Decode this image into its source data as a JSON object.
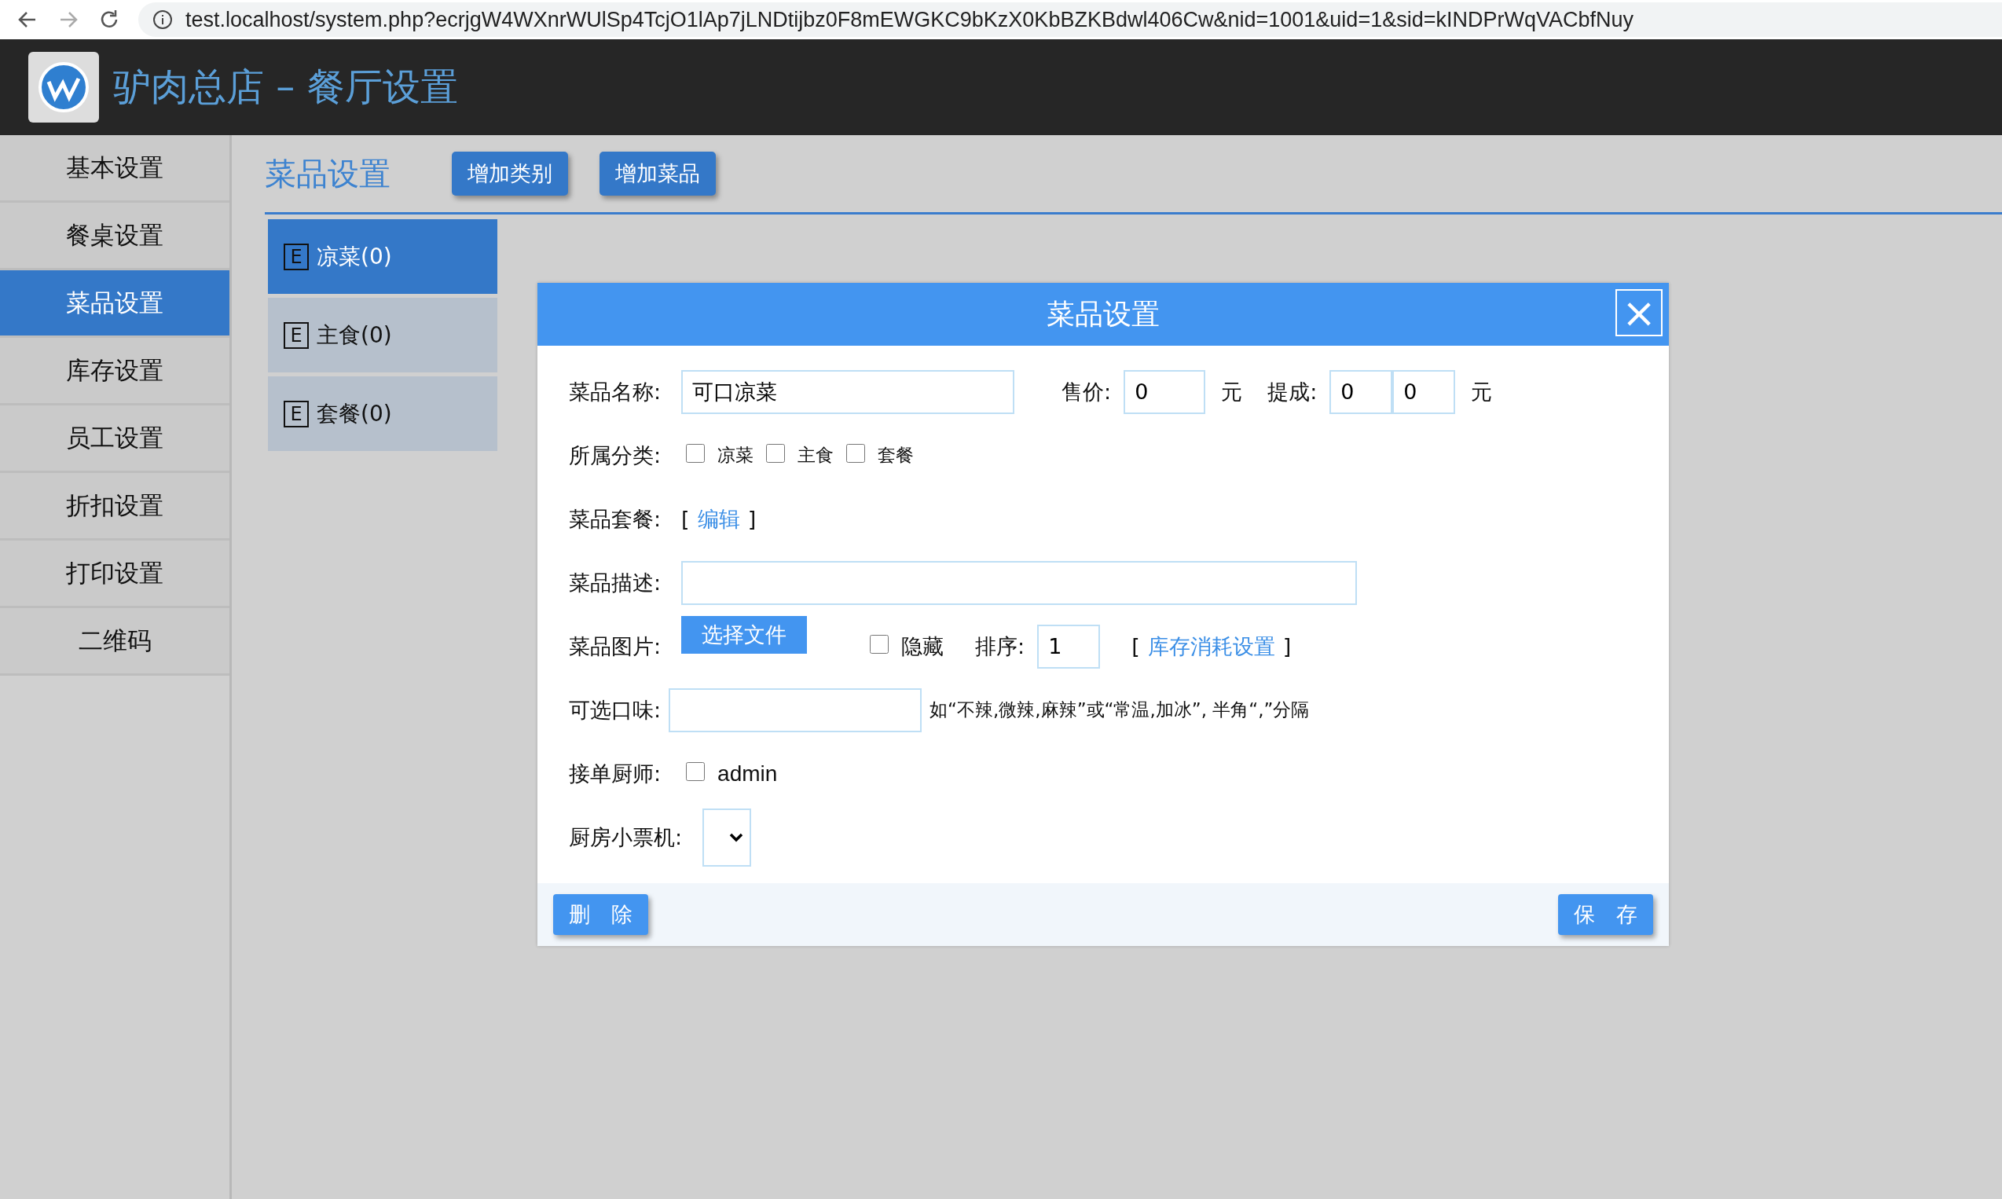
{
  "browser": {
    "url": "test.localhost/system.php?ecrjgW4WXnrWUlSp4TcjO1lAp7jLNDtijbz0F8mEWGKC9bKzX0KbBZKBdwl406Cw&nid=1001&uid=1&sid=kINDPrWqVACbfNuy"
  },
  "header": {
    "title": "驴肉总店 – 餐厅设置"
  },
  "sidebar": {
    "items": [
      {
        "label": "基本设置",
        "selected": false
      },
      {
        "label": "餐桌设置",
        "selected": false
      },
      {
        "label": "菜品设置",
        "selected": true
      },
      {
        "label": "库存设置",
        "selected": false
      },
      {
        "label": "员工设置",
        "selected": false
      },
      {
        "label": "折扣设置",
        "selected": false
      },
      {
        "label": "打印设置",
        "selected": false
      },
      {
        "label": "二维码",
        "selected": false
      }
    ]
  },
  "content": {
    "title": "菜品设置",
    "buttons": [
      "增加类别",
      "增加菜品"
    ],
    "categories": [
      {
        "icon": "E",
        "label": "凉菜(0)",
        "selected": true
      },
      {
        "icon": "E",
        "label": "主食(0)",
        "selected": false
      },
      {
        "icon": "E",
        "label": "套餐(0)",
        "selected": false
      }
    ]
  },
  "dialog": {
    "title": "菜品设置",
    "close": "×",
    "name": {
      "label": "菜品名称:",
      "value": "可口凉菜"
    },
    "price": {
      "label": "售价:",
      "value": "0",
      "unit": "元"
    },
    "commission": {
      "label": "提成:",
      "values": [
        "0",
        "0"
      ],
      "unit": "元"
    },
    "category": {
      "label": "所属分类:",
      "options": [
        {
          "label": "凉菜",
          "checked": false
        },
        {
          "label": "主食",
          "checked": false
        },
        {
          "label": "套餐",
          "checked": false
        }
      ]
    },
    "combo": {
      "label": "菜品套餐:",
      "open": "[",
      "link": "编辑",
      "close": "]"
    },
    "description": {
      "label": "菜品描述:"
    },
    "image": {
      "label": "菜品图片:",
      "button": "选择文件"
    },
    "hidden": {
      "label": "隐藏",
      "checked": false
    },
    "order": {
      "label": "排序:",
      "value": "1"
    },
    "stock": {
      "open": "[",
      "link": "库存消耗设置",
      "close": "]"
    },
    "flavors": {
      "label": "可选口味:",
      "hint": "如“不辣,微辣,麻辣”或“常温,加冰”, 半角“,”分隔"
    },
    "chefs": {
      "label": "接单厨师:",
      "options": [
        {
          "label": "admin",
          "checked": false
        }
      ]
    },
    "printer": {
      "label": "厨房小票机:"
    },
    "footer": {
      "delete": "删　除",
      "save": "保　存"
    }
  }
}
